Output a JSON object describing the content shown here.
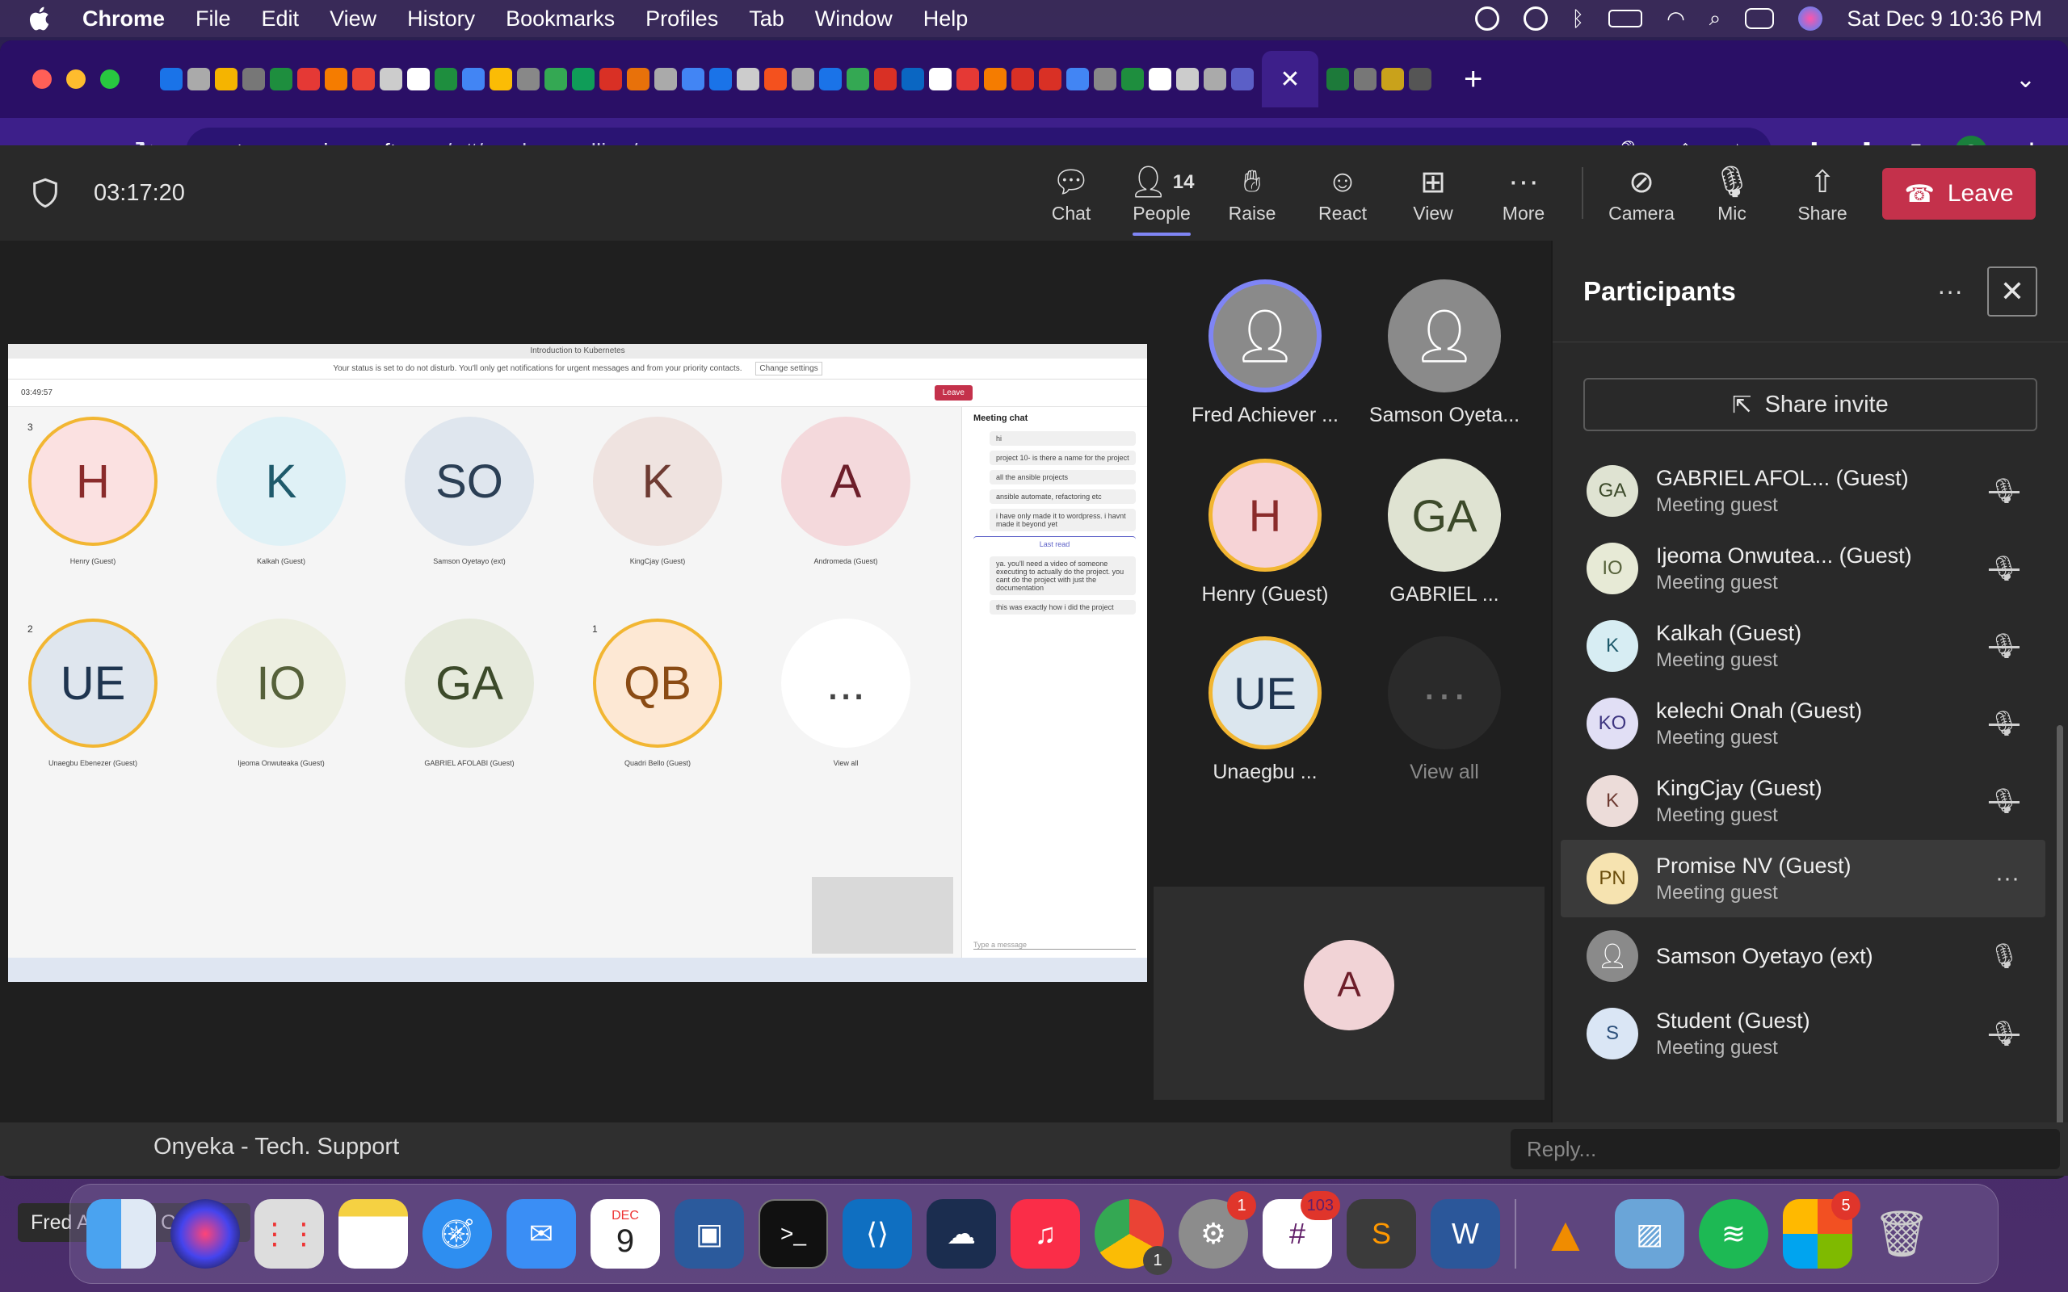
{
  "menubar": {
    "app_name": "Chrome",
    "items": [
      "File",
      "Edit",
      "View",
      "History",
      "Bookmarks",
      "Profiles",
      "Tab",
      "Window",
      "Help"
    ],
    "clock": "Sat Dec 9  10:36 PM"
  },
  "browser": {
    "url_host": "teams.microsoft.com",
    "url_path": "/_#/modern-calling/",
    "profile_initial": "S"
  },
  "meeting": {
    "timer": "03:17:20",
    "toolbar": {
      "chat": "Chat",
      "people": "People",
      "people_count": "14",
      "raise": "Raise",
      "react": "React",
      "view": "View",
      "more": "More",
      "camera": "Camera",
      "mic": "Mic",
      "share": "Share",
      "leave": "Leave"
    },
    "presenter_name": "Fred Achiever Okereke"
  },
  "shared_screen": {
    "title": "Introduction to Kubernetes",
    "notice": "Your status is set to do not disturb. You'll only get notifications for urgent messages and from your priority contacts.",
    "change_settings": "Change settings",
    "timer": "03:49:57",
    "leave": "Leave",
    "chat_title": "Meeting chat",
    "tiles": [
      {
        "initials": "H",
        "name": "Henry (Guest)",
        "hand": "3"
      },
      {
        "initials": "K",
        "name": "Kalkah (Guest)",
        "hand": ""
      },
      {
        "initials": "SO",
        "name": "Samson Oyetayo (ext)",
        "hand": ""
      },
      {
        "initials": "K",
        "name": "KingCjay (Guest)",
        "hand": ""
      },
      {
        "initials": "A",
        "name": "Andromeda (Guest)",
        "hand": ""
      },
      {
        "initials": "UE",
        "name": "Unaegbu Ebenezer (Guest)",
        "hand": "2"
      },
      {
        "initials": "IO",
        "name": "Ijeoma Onwuteaka (Guest)",
        "hand": ""
      },
      {
        "initials": "GA",
        "name": "GABRIEL AFOLABI (Guest)",
        "hand": ""
      },
      {
        "initials": "QB",
        "name": "Quadri Bello (Guest)",
        "hand": "1"
      },
      {
        "initials": "...",
        "name": "View all",
        "hand": ""
      }
    ],
    "chat_messages": [
      "hi",
      "project 10- is there a name for the project",
      "all the ansible projects",
      "ansible automate, refactoring etc",
      "i have only made it to wordpress. i havnt made it beyond yet",
      "Last read",
      "ya. you'll need a video of someone executing to actually do the project. you cant do the project with just the documentation",
      "this was exactly how i did the project"
    ],
    "type_placeholder": "Type a message"
  },
  "gallery": [
    {
      "initials": "",
      "name": "Fred Achiever ...",
      "hand": "",
      "speaking": true
    },
    {
      "initials": "",
      "name": "Samson Oyeta...",
      "hand": "",
      "speaking": false
    },
    {
      "initials": "H",
      "name": "Henry (Guest)",
      "hand": "3",
      "speaking": false
    },
    {
      "initials": "GA",
      "name": "GABRIEL ...",
      "hand": "",
      "speaking": false
    },
    {
      "initials": "UE",
      "name": "Unaegbu ...",
      "hand": "2",
      "speaking": false
    },
    {
      "initials": "···",
      "name": "View all",
      "hand": "",
      "speaking": false
    }
  ],
  "spotlight": {
    "initials": "A"
  },
  "participants": {
    "title": "Participants",
    "share_invite": "Share invite",
    "list": [
      {
        "initials": "GA",
        "name": "GABRIEL AFOL...  (Guest)",
        "sub": "Meeting guest",
        "status": "muted",
        "bg": "#dfe3d2",
        "fg": "#3c4a2a"
      },
      {
        "initials": "IO",
        "name": "Ijeoma Onwutea... (Guest)",
        "sub": "Meeting guest",
        "status": "muted",
        "bg": "#e7ead6",
        "fg": "#56613a"
      },
      {
        "initials": "K",
        "name": "Kalkah (Guest)",
        "sub": "Meeting guest",
        "status": "muted",
        "bg": "#d7edf3",
        "fg": "#1e5a6b"
      },
      {
        "initials": "KO",
        "name": "kelechi Onah (Guest)",
        "sub": "Meeting guest",
        "status": "muted",
        "bg": "#e1dff5",
        "fg": "#3d3580"
      },
      {
        "initials": "K",
        "name": "KingCjay (Guest)",
        "sub": "Meeting guest",
        "status": "muted",
        "bg": "#ecdcd9",
        "fg": "#6e3b33"
      },
      {
        "initials": "PN",
        "name": "Promise NV (Guest)",
        "sub": "Meeting guest",
        "status": "more",
        "bg": "#f6e3b0",
        "fg": "#6b4d0c"
      },
      {
        "initials": "",
        "name": "Samson Oyetayo (ext)",
        "sub": "",
        "status": "mic",
        "bg": "#8a8a8a",
        "fg": "#ffffff"
      },
      {
        "initials": "S",
        "name": "Student (Guest)",
        "sub": "Meeting guest",
        "status": "muted",
        "bg": "#dae6f5",
        "fg": "#2b4f7a"
      }
    ]
  },
  "behind": {
    "chat_name": "Onyeka - Tech. Support",
    "reply_placeholder": "Reply..."
  },
  "dock": {
    "calendar_month": "DEC",
    "calendar_day": "9",
    "badges": {
      "settings": "1",
      "slack": "103",
      "office": "5",
      "chrome": "1"
    }
  }
}
